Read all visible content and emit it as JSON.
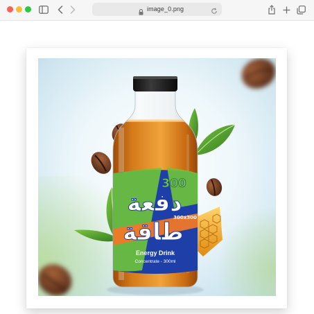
{
  "browser": {
    "address_bar": {
      "url": "image_0.png"
    }
  },
  "image": {
    "product_label": {
      "arabic_line_1": "دفعة",
      "arabic_line_2": "طاقة",
      "volume_badge": "300",
      "volume_small": "300x300",
      "product_name": "Energy Drink",
      "product_detail": "Concentrate - 300ml"
    },
    "colors": {
      "label_blue": "#1f3fa8",
      "label_green": "#6fc43a",
      "liquid": "#c96b12",
      "cap": "#1b1b1b"
    }
  }
}
